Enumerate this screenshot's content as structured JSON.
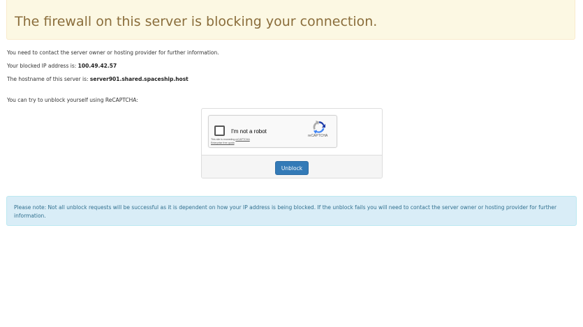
{
  "warning": {
    "title": "The firewall on this server is blocking your connection."
  },
  "info": {
    "contact_line": "You need to contact the server owner or hosting provider for further information.",
    "ip_label": "Your blocked IP address is: ",
    "ip_value": "100.49.42.57",
    "host_label": "The hostname of this server is: ",
    "host_value": "server901.shared.spaceship.host",
    "recaptcha_prompt": "You can try to unblock yourself using ReCAPTCHA:"
  },
  "recaptcha": {
    "checkbox_label": "I'm not a robot",
    "quota_prefix": "This site is exceeding ",
    "quota_link": "reCAPTCHA",
    "quota_link2": "Enterprise free quota",
    "brand": "reCAPTCHA"
  },
  "buttons": {
    "unblock_label": "Unblock"
  },
  "note": {
    "text": "Please note: Not all unblock requests will be successful as it is dependent on how your IP address is being blocked. If the unblock fails you will need to contact the server owner or hosting provider for further information."
  },
  "colors": {
    "warning_bg": "#fcf8e3",
    "warning_text": "#8a6d3b",
    "info_bg": "#d9edf7",
    "info_text": "#31708f",
    "primary_button": "#337ab7"
  }
}
